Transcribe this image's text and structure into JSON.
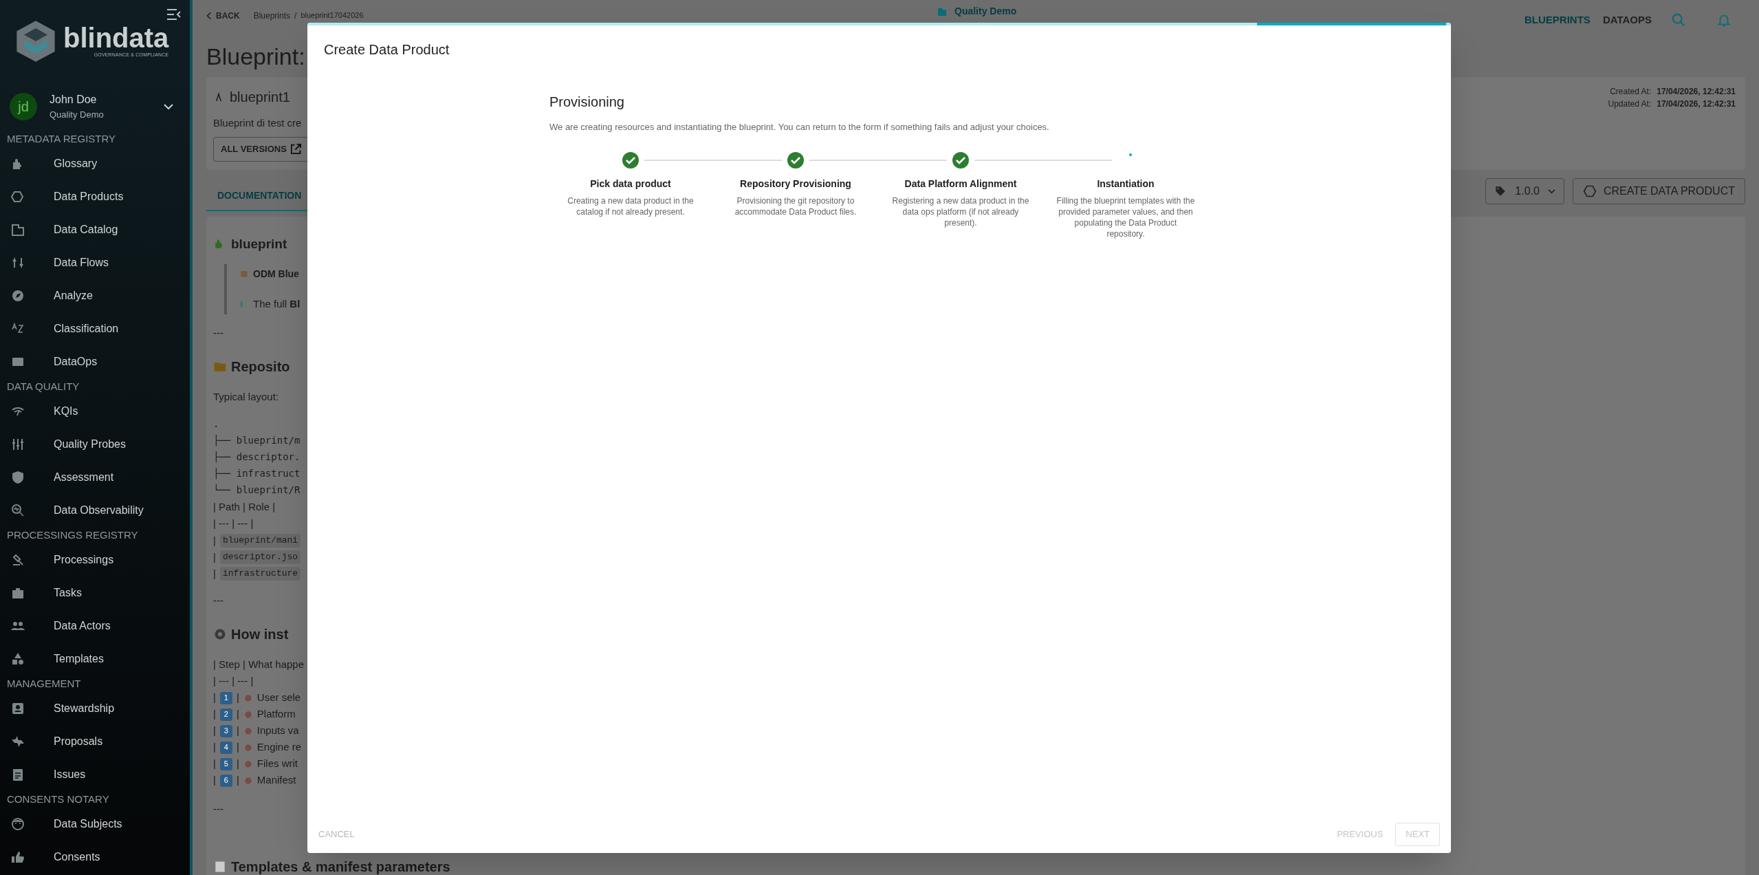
{
  "sidebar": {
    "logo": {
      "name": "blindata",
      "tagline": "GOVERNANCE & COMPLIANCE"
    },
    "user": {
      "initials": "jd",
      "name": "John Doe",
      "tenant": "Quality Demo"
    },
    "sections": [
      {
        "title": "METADATA REGISTRY",
        "items": [
          "Glossary",
          "Data Products",
          "Data Catalog",
          "Data Flows",
          "Analyze",
          "Classification",
          "DataOps"
        ]
      },
      {
        "title": "DATA QUALITY",
        "items": [
          "KQIs",
          "Quality Probes",
          "Assessment",
          "Data Observability"
        ]
      },
      {
        "title": "PROCESSINGS REGISTRY",
        "items": [
          "Processings",
          "Tasks",
          "Data Actors",
          "Templates"
        ]
      },
      {
        "title": "MANAGEMENT",
        "items": [
          "Stewardship",
          "Proposals",
          "Issues"
        ]
      },
      {
        "title": "CONSENTS NOTARY",
        "items": [
          "Data Subjects",
          "Consents"
        ]
      }
    ]
  },
  "topbar": {
    "tenant": "Quality Demo",
    "nav": [
      "BLUEPRINTS",
      "DATAOPS"
    ]
  },
  "breadcrumb": {
    "back": "BACK",
    "items": [
      "Blueprints",
      "blueprint17042026"
    ],
    "separator": "/"
  },
  "page_title": "Blueprint:",
  "header_card": {
    "name": "blueprint1",
    "description": "Blueprint di test cre",
    "versions_button": "ALL VERSIONS",
    "created_label": "Created At:",
    "created": "17/04/2026, 12:42:31",
    "updated_label": "Updated At:",
    "updated": "17/04/2026, 12:42:31"
  },
  "tabs": [
    {
      "label": "DOCUMENTATION",
      "selected": true
    }
  ],
  "version_select": {
    "value": "1.0.0"
  },
  "create_button": "CREATE DATA PRODUCT",
  "documentation": {
    "title": "blueprint",
    "quote": [
      "ODM Blue",
      "The full **Bl**"
    ],
    "rule": "---",
    "repo_heading": "Reposito",
    "layout_label": "Typical layout:",
    "tree": [
      ".",
      "├── blueprint/m",
      "├── descriptor.",
      "├── infrastruct",
      "└── blueprint/R"
    ],
    "pipe": "|",
    "table1_rows": [
      "| Path | Role |",
      "| --- | --- |"
    ],
    "table1_code": [
      "blueprint/mani",
      "descriptor.jso",
      "infrastructure"
    ],
    "rule2": "---",
    "how_heading": "How inst",
    "table2_rows": [
      "| Step | What happe",
      "| --- | --- |"
    ],
    "steps": [
      {
        "number": "1",
        "text": "User sele"
      },
      {
        "number": "2",
        "text": "Platform"
      },
      {
        "number": "3",
        "text": "Inputs va"
      },
      {
        "number": "4",
        "text": "Engine re"
      },
      {
        "number": "5",
        "text": "Files writ"
      },
      {
        "number": "6",
        "text": "Manifest"
      }
    ],
    "rule3": "---",
    "templates_heading": "Templates & manifest parameters"
  },
  "dialog": {
    "title": "Create Data Product",
    "heading": "Provisioning",
    "description": "We are creating resources and instantiating the blueprint. You can return to the form if something fails and adjust your choices.",
    "steps": [
      {
        "title": "Pick data product",
        "description": "Creating a new data product in the catalog if not already present.",
        "completed": true
      },
      {
        "title": "Repository Provisioning",
        "description": "Provisioning the git repository to accommodate Data Product files.",
        "completed": true
      },
      {
        "title": "Data Platform Alignment",
        "description": "Registering a new data product in the data ops platform (if not already present).",
        "completed": true
      },
      {
        "title": "Instantiation",
        "description": "Filling the blueprint templates with the provided parameter values, and then populating the Data Product repository.",
        "completed": false
      }
    ],
    "cancel": "CANCEL",
    "previous": {
      "label": "PREVIOUS",
      "disabled": true
    },
    "next": {
      "label": "NEXT",
      "disabled": true
    }
  }
}
